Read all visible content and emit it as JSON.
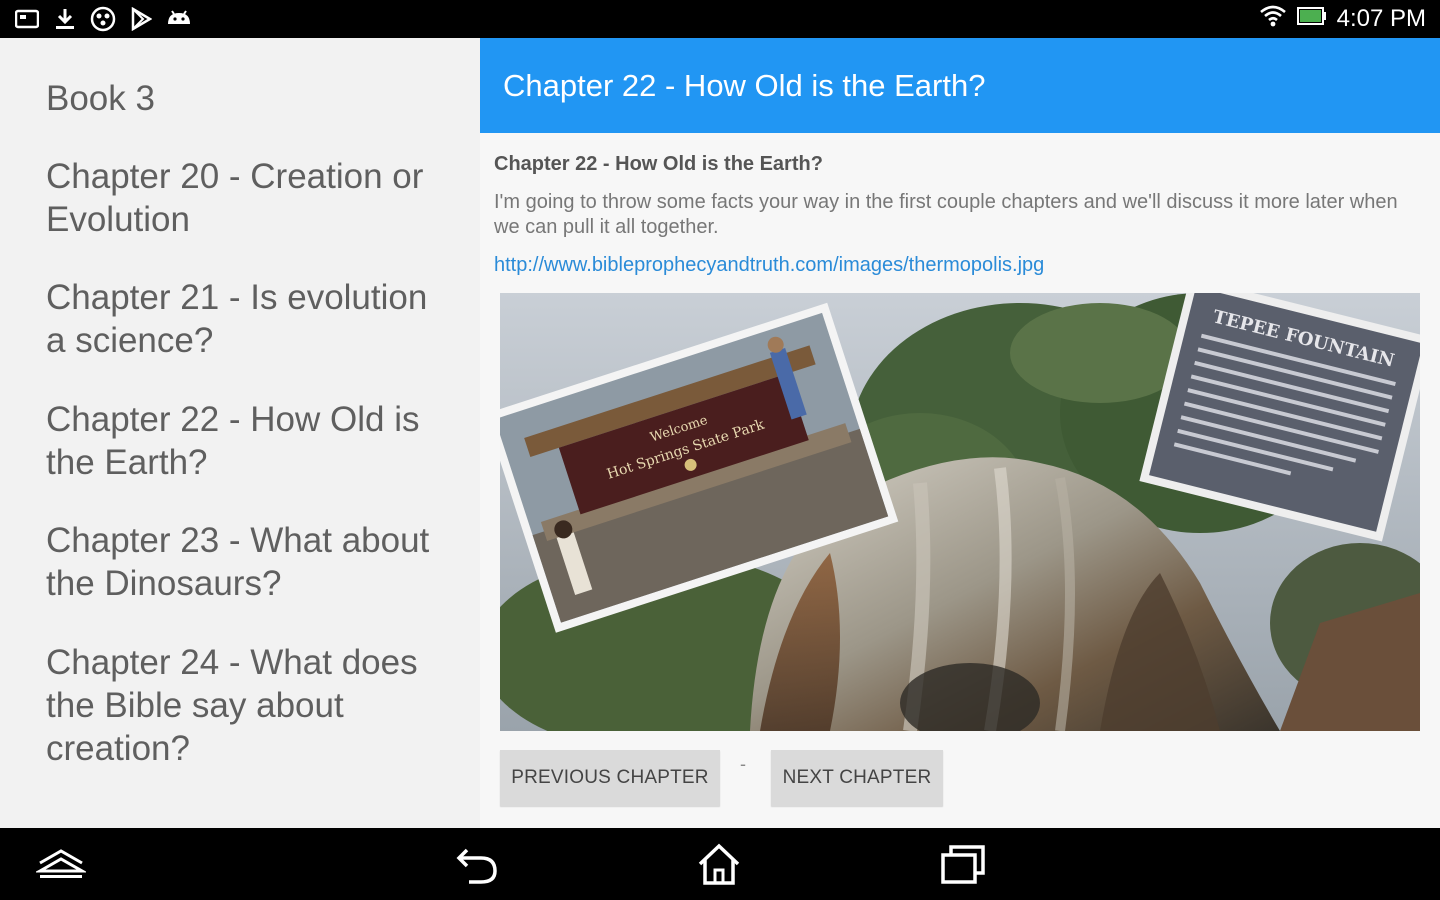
{
  "status_bar": {
    "time": "4:07 PM",
    "left_icons": [
      "gallery-icon",
      "download-icon",
      "game-controller-icon",
      "play-store-icon",
      "android-icon"
    ],
    "right_icons": [
      "wifi-icon",
      "battery-icon"
    ]
  },
  "sidebar": {
    "items": [
      {
        "label": "Book 3"
      },
      {
        "label": "Chapter 20 - Creation or Evolution"
      },
      {
        "label": "Chapter 21 - Is evolution a science?"
      },
      {
        "label": "Chapter 22 - How Old is the Earth?"
      },
      {
        "label": "Chapter 23 - What about the Dinosaurs?"
      },
      {
        "label": "Chapter 24 - What does the Bible say about creation?"
      }
    ]
  },
  "content": {
    "header_title": "Chapter 22 - How Old is the Earth?",
    "heading": "Chapter 22 - How Old is the Earth?",
    "body": "I'm going to throw some facts your way in the first couple chapters and we'll discuss it more later when we can pull it all together.",
    "link": "http://www.bibleprophecyandtruth.com/images/thermopolis.jpg",
    "image": {
      "sign_lines": [
        "Welcome",
        "Hot Springs State Park"
      ],
      "plaque_title": "TEPEE FOUNTAIN"
    },
    "prev_button": "PREVIOUS CHAPTER",
    "separator": "-",
    "next_button": "NEXT CHAPTER"
  },
  "nav_bar": {
    "icons": [
      "overview-icon",
      "back-icon",
      "home-icon",
      "recent-apps-icon"
    ]
  },
  "colors": {
    "header_blue": "#2196f3",
    "sidebar_bg": "#f2f2f2",
    "link_blue": "#2a8bd8",
    "button_bg": "#dadada"
  }
}
